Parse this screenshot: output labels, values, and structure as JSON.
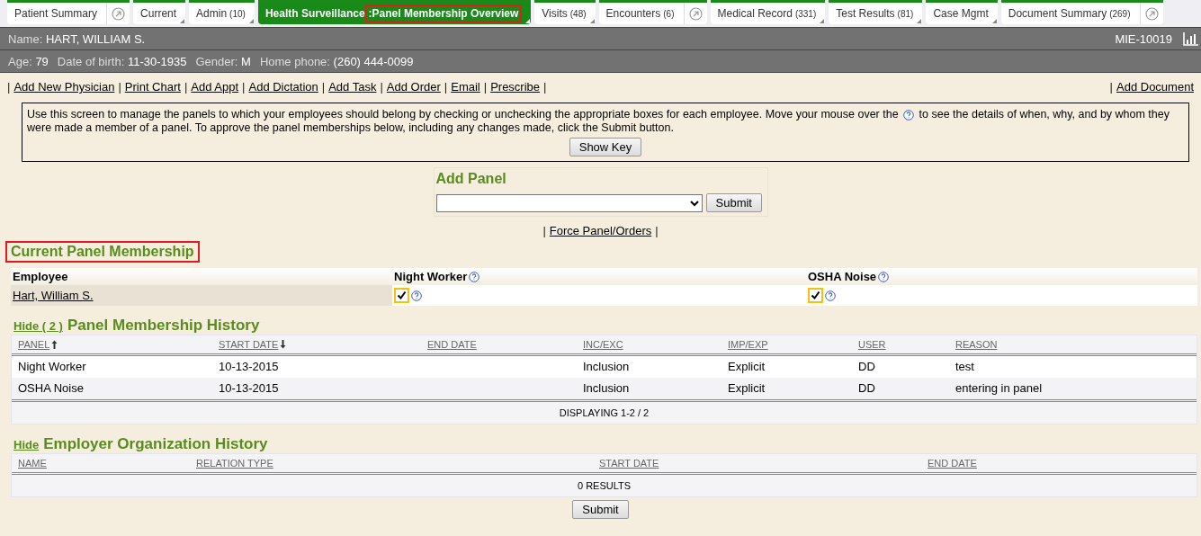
{
  "tabs": [
    {
      "label": "Patient Summary",
      "selected": false,
      "kind": "popout"
    },
    {
      "label": "Current",
      "selected": false,
      "kind": "menu"
    },
    {
      "label": "Admin",
      "count": "(10)",
      "selected": false,
      "kind": "menu"
    },
    {
      "label": "Health Surveillance",
      "sublabel": ":Panel Membership Overview",
      "sublabel_highlighted": true,
      "selected": true,
      "kind": "menu"
    },
    {
      "label": "Visits",
      "count": "(48)",
      "selected": false,
      "kind": "menu"
    },
    {
      "label": "Encounters",
      "count": "(6)",
      "selected": false,
      "kind": "popout"
    },
    {
      "label": "Medical Record",
      "count": "(331)",
      "selected": false,
      "kind": "menu"
    },
    {
      "label": "Test Results",
      "count": "(81)",
      "selected": false,
      "kind": "menu"
    },
    {
      "label": "Case Mgmt",
      "selected": false,
      "kind": "menu"
    },
    {
      "label": "Document Summary",
      "count": "(269)",
      "selected": false,
      "kind": "popout"
    }
  ],
  "patient": {
    "name_label": "Name:",
    "name": "HART, WILLIAM S.",
    "id": "MIE-10019",
    "details": [
      {
        "label": "Age:",
        "value": "79"
      },
      {
        "label": "Date of birth:",
        "value": "11-30-1935"
      },
      {
        "label": "Gender:",
        "value": "M"
      },
      {
        "label": "Home phone:",
        "value": "(260) 444-0099"
      }
    ]
  },
  "link_separator": "|",
  "action_links": [
    "Add New Physician",
    "Print Chart",
    "Add Appt",
    "Add Dictation",
    "Add Task",
    "Add Order",
    "Email",
    "Prescribe"
  ],
  "right_links": [
    "Add Document"
  ],
  "info": {
    "text_before": "Use this screen to manage the panels to which your employees should belong by checking or unchecking the appropriate boxes for each employee. Move your mouse over the",
    "text_after": "to see the details of when, why, and by whom they were made a member of a panel. To approve the panel memberships below, including any changes made, click the Submit button.",
    "button": "Show Key"
  },
  "add_panel": {
    "title": "Add Panel",
    "button": "Submit"
  },
  "force_link": "Force Panel/Orders",
  "current_membership": {
    "title": "Current Panel Membership",
    "highlighted": true,
    "employee_header": "Employee",
    "panels": [
      "Night Worker",
      "OSHA Noise"
    ],
    "rows": [
      {
        "employee": "Hart, William S.",
        "checked": [
          true,
          true
        ]
      }
    ]
  },
  "history": {
    "toggle": "Hide ( 2 )",
    "title": "Panel Membership History",
    "columns": [
      {
        "label": "PANEL",
        "sorted": true,
        "descending": false
      },
      {
        "label": "START DATE",
        "sorted": true,
        "descending": true
      },
      {
        "label": "END DATE",
        "sorted": false
      },
      {
        "label": "INC/EXC",
        "sorted": false
      },
      {
        "label": "IMP/EXP",
        "sorted": false
      },
      {
        "label": "USER",
        "sorted": false
      },
      {
        "label": "REASON",
        "sorted": false
      }
    ],
    "rows": [
      [
        "Night Worker",
        "10-13-2015",
        "",
        "Inclusion",
        "Explicit",
        "DD",
        "test"
      ],
      [
        "OSHA Noise",
        "10-13-2015",
        "",
        "Inclusion",
        "Explicit",
        "DD",
        "entering in panel"
      ]
    ],
    "footer": "DISPLAYING 1-2 / 2"
  },
  "employer": {
    "toggle": "Hide",
    "title": "Employer Organization History",
    "columns": [
      "NAME",
      "RELATION TYPE",
      "START DATE",
      "END DATE"
    ],
    "footer": "0 RESULTS"
  },
  "submit": "Submit"
}
